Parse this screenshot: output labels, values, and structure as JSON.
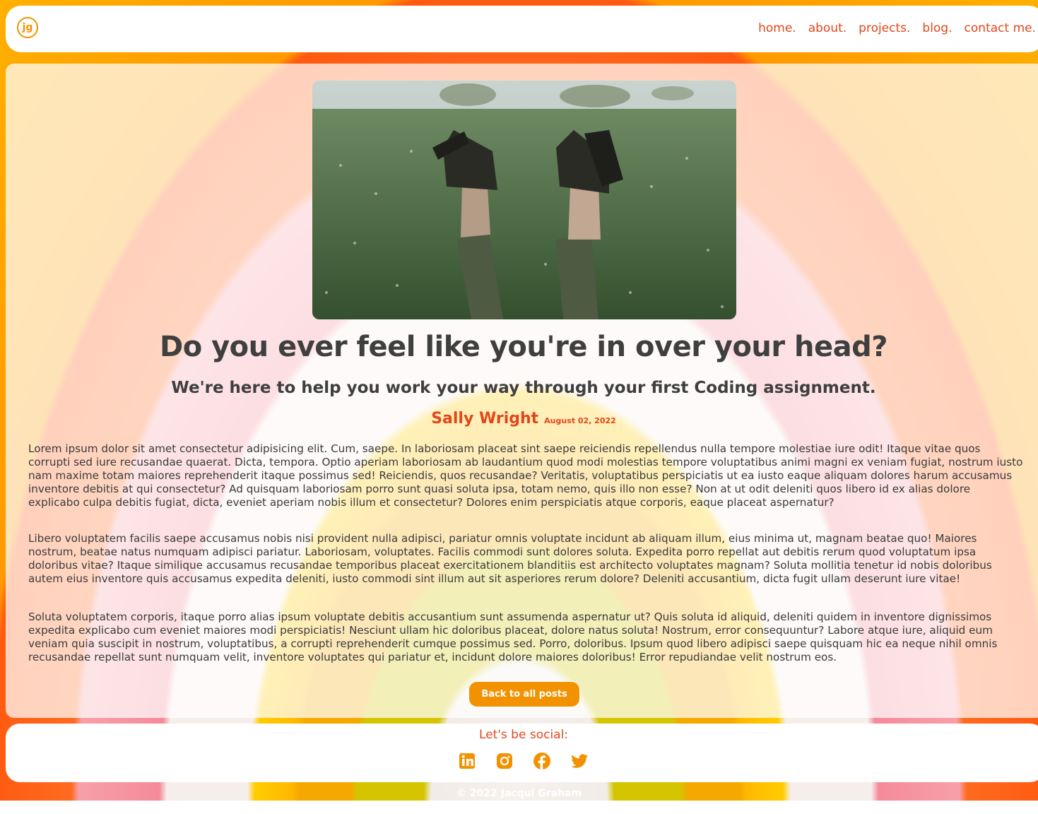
{
  "nav": {
    "logo_text": "jg",
    "links": [
      "home.",
      "about.",
      "projects.",
      "blog.",
      "contact me."
    ]
  },
  "post": {
    "hero_image": "boots-in-flower-field",
    "title": "Do you ever feel like you're in over your head?",
    "subtitle": "We're here to help you work your way through your first Coding assignment.",
    "author": "Sally Wright",
    "date": "August 02, 2022",
    "paragraphs": [
      "Lorem ipsum dolor sit amet consectetur adipisicing elit. Cum, saepe. In laboriosam placeat sint saepe reiciendis repellendus nulla tempore molestiae iure odit! Itaque vitae quos corrupti sed iure recusandae quaerat. Dicta, tempora. Optio aperiam laboriosam ab laudantium quod modi molestias tempore voluptatibus animi magni ex veniam fugiat, nostrum iusto nam maxime totam maiores reprehenderit itaque possimus sed! Reiciendis, quos recusandae? Veritatis, voluptatibus perspiciatis ut ea iusto eaque aliquam dolores harum accusamus inventore debitis at qui consectetur? Ad quisquam laboriosam porro sunt quasi soluta ipsa, totam nemo, quis illo non esse? Non at ut odit deleniti quos libero id ex alias dolore explicabo culpa debitis fugiat, dicta, eveniet aperiam nobis illum et consectetur? Dolores enim perspiciatis atque corporis, eaque placeat aspernatur?",
      "Libero voluptatem facilis saepe accusamus nobis nisi provident nulla adipisci, pariatur omnis voluptate incidunt ab aliquam illum, eius minima ut, magnam beatae quo! Maiores nostrum, beatae natus numquam adipisci pariatur. Laboriosam, voluptates. Facilis commodi sunt dolores soluta. Expedita porro repellat aut debitis rerum quod voluptatum ipsa doloribus vitae? Itaque similique accusamus recusandae temporibus placeat exercitationem blanditiis est architecto voluptates magnam? Soluta mollitia tenetur id nobis doloribus autem eius inventore quis accusamus expedita deleniti, iusto commodi sint illum aut sit asperiores rerum dolore? Deleniti accusantium, dicta fugit ullam deserunt iure vitae!",
      "Soluta voluptatem corporis, itaque porro alias ipsum voluptate debitis accusantium sunt assumenda aspernatur ut? Quis soluta id aliquid, deleniti quidem in inventore dignissimos expedita explicabo cum eveniet maiores modi perspiciatis! Nesciunt ullam hic doloribus placeat, dolore natus soluta! Nostrum, error consequuntur? Labore atque iure, aliquid eum veniam quia suscipit in nostrum, voluptatibus, a corrupti reprehenderit cumque possimus sed. Porro, doloribus. Ipsum quod libero adipisci saepe quisquam hic ea neque nihil omnis recusandae repellat sunt numquam velit, inventore voluptates qui pariatur et, incidunt dolore maiores doloribus! Error repudiandae velit nostrum eos."
    ],
    "back_button": "Back to all posts"
  },
  "footer": {
    "social_title": "Let's be social:",
    "icons": [
      "linkedin-icon",
      "instagram-icon",
      "facebook-icon",
      "twitter-icon"
    ],
    "copyright": "© 2022 Jacqui Graham"
  },
  "colors": {
    "accent": "#e2461a",
    "button": "#f39200",
    "text": "#3f3f3f"
  }
}
